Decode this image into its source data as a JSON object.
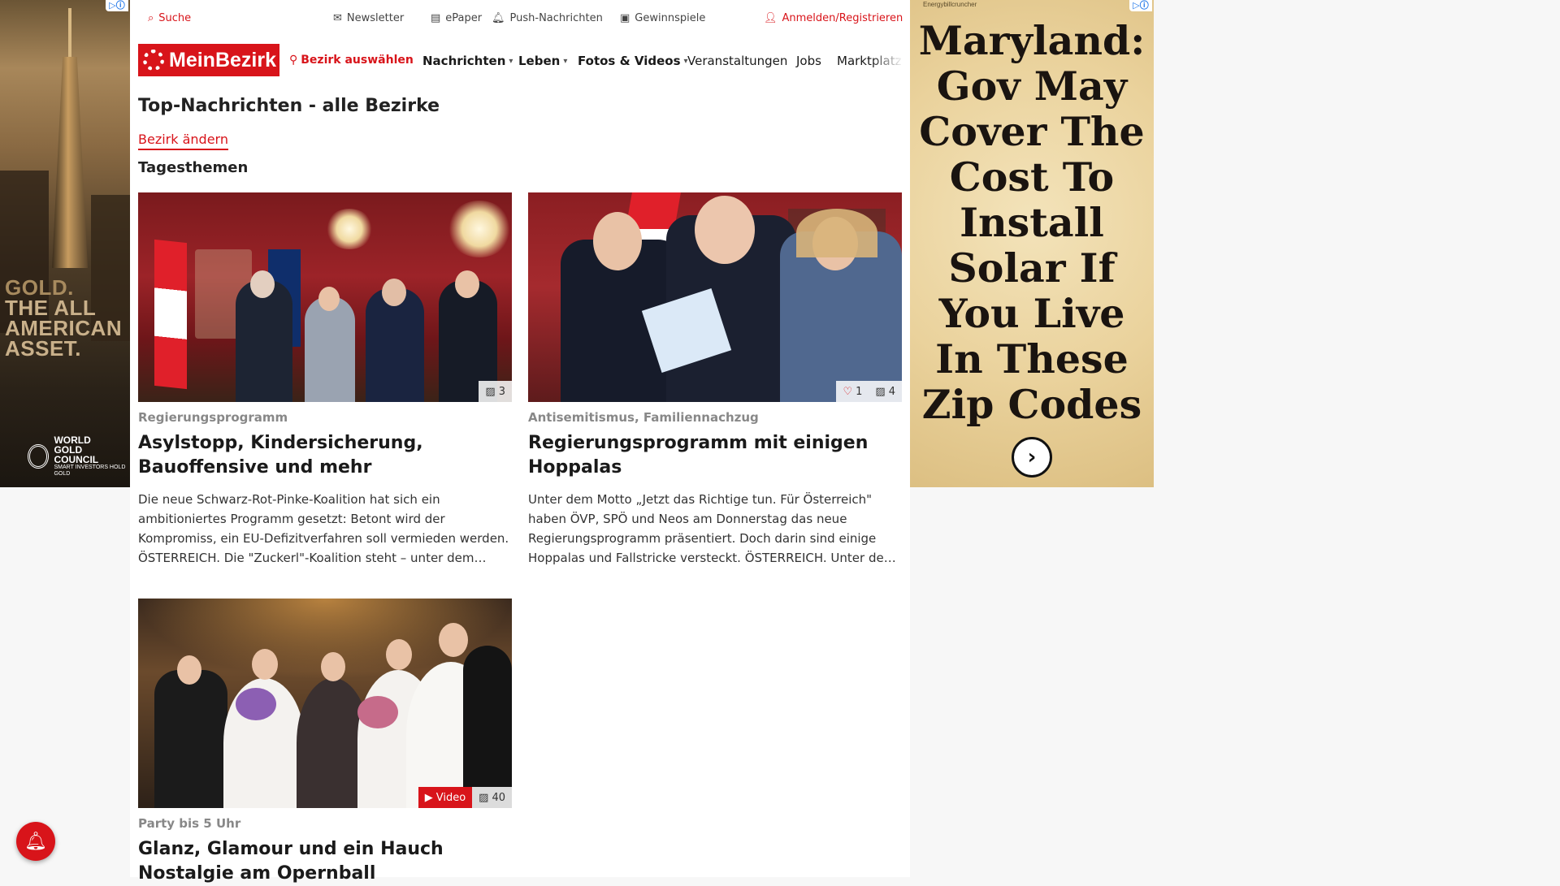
{
  "ads": {
    "left": {
      "text_line1": "GOLD.",
      "text_line2": "THE ALL",
      "text_line3": "AMERICAN",
      "text_line4": "ASSET.",
      "brand": "WORLD GOLD COUNCIL",
      "tagline": "SMART INVESTORS HOLD GOLD"
    },
    "right": {
      "sponsor": "Energybillcruncher",
      "headline": "Maryland: Gov May Cover The Cost To Install Solar If You Live In These Zip Codes",
      "cta_icon": "arrow-right-circle-icon"
    },
    "adchoices_icon": "info-icon"
  },
  "utilbar": {
    "search": "Suche",
    "newsletter": "Newsletter",
    "epaper": "ePaper",
    "push": "Push-Nachrichten",
    "gewinnspiele": "Gewinnspiele",
    "login": "Anmelden/Registrieren"
  },
  "nav": {
    "logo": "MeinBezirk",
    "select_district": "Bezirk auswählen",
    "items": [
      "Nachrichten",
      "Leben",
      "Fotos & Videos",
      "Veranstaltungen",
      "Jobs",
      "Marktplatz"
    ]
  },
  "page": {
    "title": "Top-Nachrichten - alle Bezirke",
    "change_district": "Bezirk ändern",
    "section": "Tagesthemen"
  },
  "articles": [
    {
      "category": "Regierungsprogramm",
      "headline": "Asylstopp, Kindersicherung, Bauoffensive und mehr",
      "teaser": "Die neue Schwarz-Rot-Pinke-Koalition hat sich ein ambitioniertes Programm gesetzt: Betont wird der Kompromiss, ein EU-Defizitverfahren soll vermieden werden.  ÖSTERREICH. Die \"Zuckerl\"-Koalition steht – unter dem Motto",
      "photos": "3"
    },
    {
      "category": "Antisemitismus, Familiennachzug",
      "headline": "Regierungsprogramm mit einigen Hoppalas",
      "teaser": "Unter dem Motto „Jetzt das Richtige tun. Für Österreich\" haben ÖVP, SPÖ und Neos am Donnerstag das neue Regierungsprogramm präsentiert. Doch darin sind einige Hoppalas und Fallstricke versteckt. ÖSTERREICH. Unter dem Motto",
      "likes": "1",
      "photos": "4"
    },
    {
      "category": "Party bis 5 Uhr",
      "headline": "Glanz, Glamour und ein Hauch Nostalgie am Opernball",
      "video_label": "Video",
      "photos": "40"
    }
  ],
  "colors": {
    "brand_red": "#d8141a"
  }
}
